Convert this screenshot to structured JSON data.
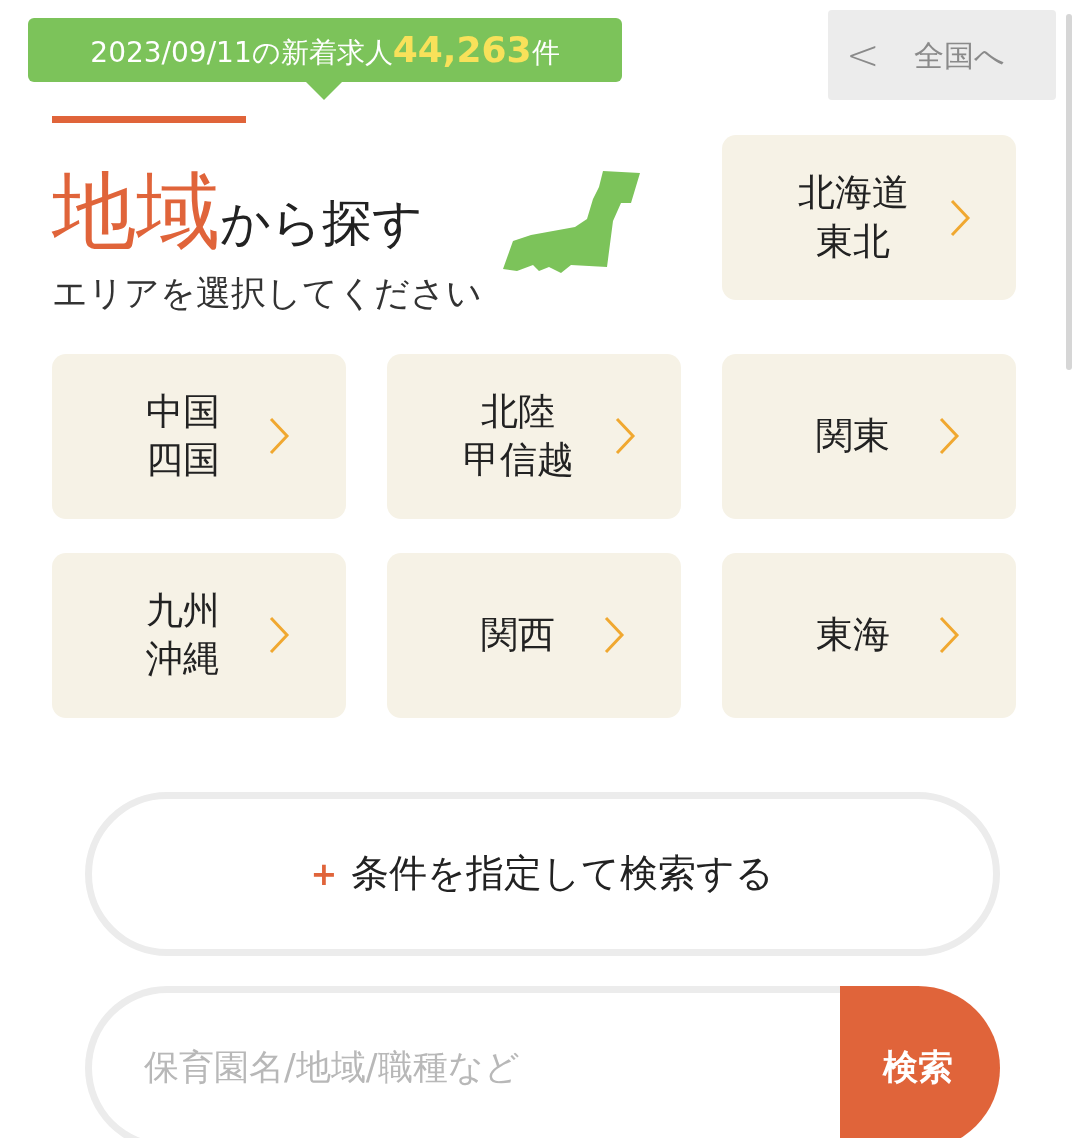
{
  "header": {
    "date_text": "2023/09/11の新着求人",
    "count": "44,263",
    "unit": "件",
    "back_button": {
      "arrow": "<",
      "label": "全国へ"
    }
  },
  "heading": {
    "highlight": "地域",
    "rest": "から探す",
    "subtitle": "エリアを選択してください"
  },
  "regions": [
    {
      "lines": [
        "北海道",
        "東北"
      ]
    },
    {
      "lines": [
        "中国",
        "四国"
      ]
    },
    {
      "lines": [
        "北陸",
        "甲信越"
      ]
    },
    {
      "lines": [
        "関東"
      ]
    },
    {
      "lines": [
        "九州",
        "沖縄"
      ]
    },
    {
      "lines": [
        "関西"
      ]
    },
    {
      "lines": [
        "東海"
      ]
    }
  ],
  "conditions_button": {
    "plus": "+",
    "label": "条件を指定して検索する"
  },
  "search": {
    "placeholder": "保育園名/地域/職種など",
    "button": "検索"
  }
}
